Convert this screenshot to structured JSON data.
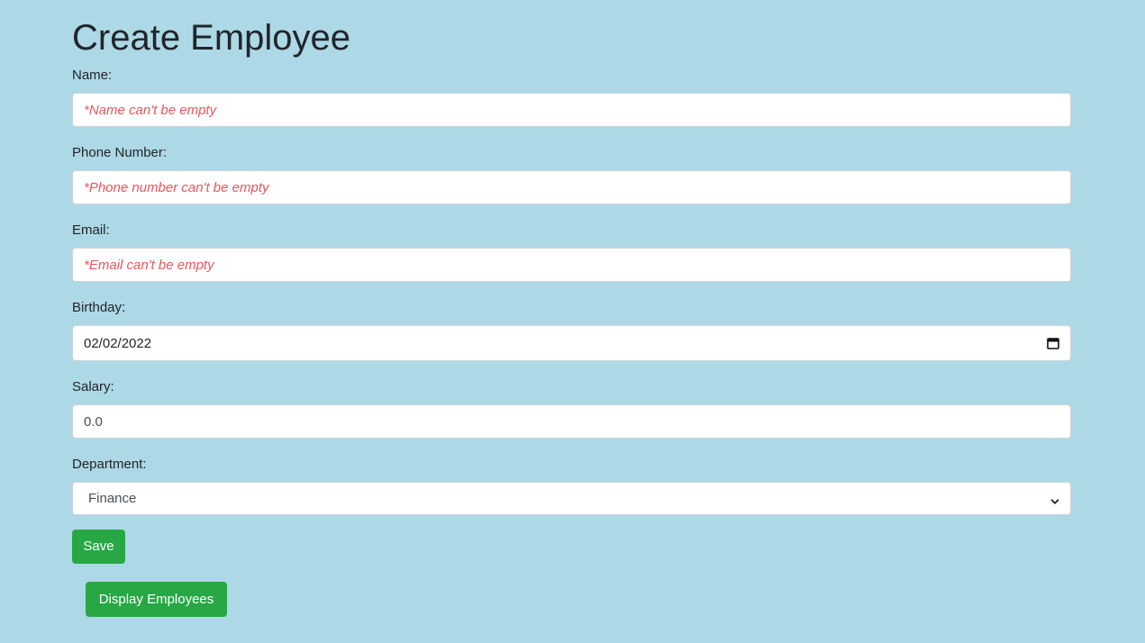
{
  "page": {
    "title": "Create Employee"
  },
  "form": {
    "name": {
      "label": "Name:",
      "placeholder": "*Name can't be empty"
    },
    "phone": {
      "label": "Phone Number:",
      "placeholder": "*Phone number can't be empty"
    },
    "email": {
      "label": "Email:",
      "placeholder": "*Email can't be empty"
    },
    "birthday": {
      "label": "Birthday:",
      "value": "02/02/2022",
      "icon": "calendar-icon"
    },
    "salary": {
      "label": "Salary:",
      "value": "0.0"
    },
    "department": {
      "label": "Department:",
      "selected": "Finance",
      "icon": "chevron-down-icon"
    }
  },
  "buttons": {
    "save": "Save",
    "display_employees": "Display Employees"
  },
  "colors": {
    "background": "#add8e6",
    "button": "#28a745",
    "placeholder": "#e0595f"
  }
}
